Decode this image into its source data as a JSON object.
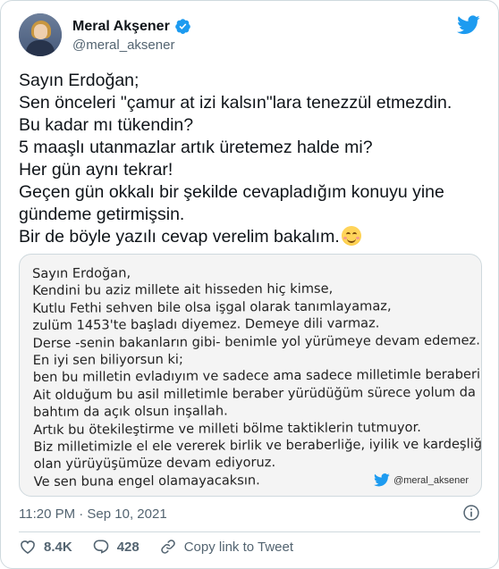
{
  "header": {
    "display_name": "Meral Akşener",
    "handle": "@meral_aksener"
  },
  "tweet": {
    "lines": [
      "Sayın Erdoğan;",
      "Sen önceleri \"çamur at izi kalsın\"lara tenezzül etmezdin.",
      "Bu kadar mı tükendin?",
      "5 maaşlı utanmazlar artık üretemez halde mi?",
      "Her gün aynı tekrar!",
      "Geçen gün okkalı bir şekilde cevapladığım konuyu yine",
      "gündeme getirmişsin.",
      "Bir de böyle yazılı cevap verelim bakalım."
    ]
  },
  "media": {
    "lines": [
      "Sayın Erdoğan,",
      "Kendini bu aziz millete ait hisseden hiç kimse,",
      "Kutlu Fethi sehven bile olsa işgal olarak tanımlayamaz,",
      "zulüm 1453'te başladı diyemez. Demeye dili varmaz.",
      "Derse -senin bakanların gibi- benimle yol yürümeye devam edemez.",
      "En iyi sen biliyorsun ki;",
      "ben bu milletin evladıyım ve sadece ama sadece milletimle beraberim.",
      "Ait olduğum bu asil milletimle beraber yürüdüğüm sürece yolum da",
      "bahtım da açık olsun inşallah.",
      "Artık bu ötekileştirme ve milleti bölme taktiklerin tutmuyor.",
      "Biz milletimizle el ele vererek birlik ve beraberliğe, iyilik ve kardeşliğe",
      "olan yürüyüşümüze devam ediyoruz.",
      "Ve sen buna engel olamayacaksın."
    ],
    "watermark": "@meral_aksener"
  },
  "footer": {
    "timestamp": "11:20 PM · Sep 10, 2021",
    "like_count": "8.4K",
    "reply_count": "428",
    "copy_link_label": "Copy link to Tweet"
  },
  "colors": {
    "twitter_blue": "#1d9bf0",
    "secondary_text": "#536471",
    "border": "#cfd9de"
  },
  "icons": [
    "verified-badge-icon",
    "twitter-bird-icon",
    "smiling-face-emoji",
    "info-icon",
    "heart-icon",
    "reply-bubble-icon",
    "link-icon"
  ]
}
